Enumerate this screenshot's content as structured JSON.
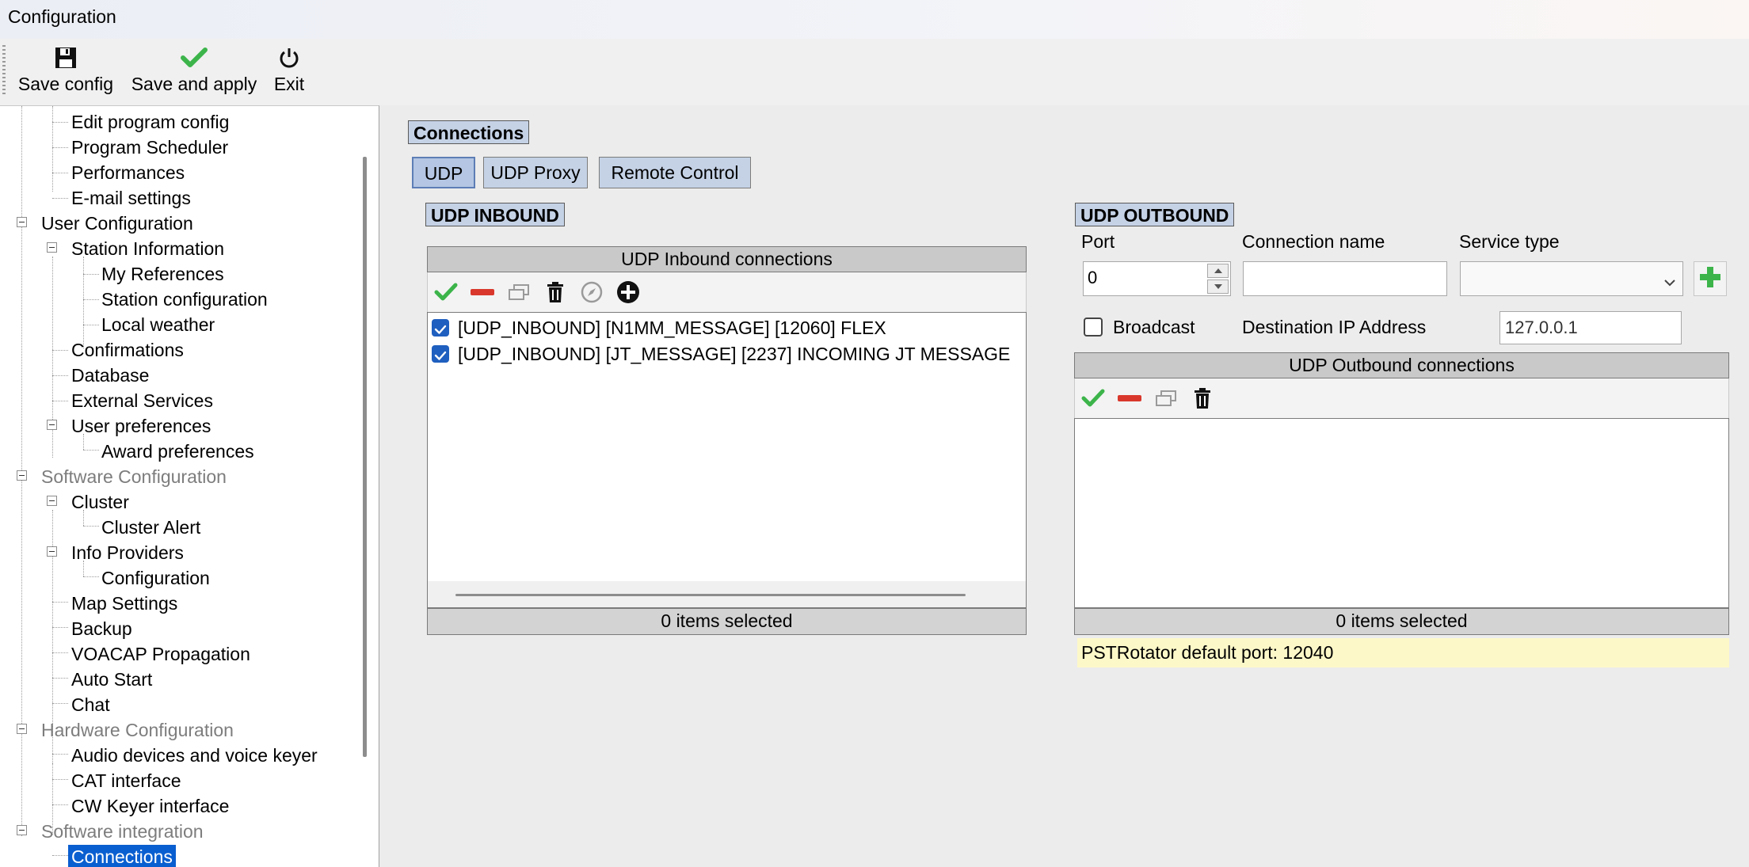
{
  "window": {
    "title": "Configuration"
  },
  "toolbar": {
    "save_config": "Save config",
    "save_apply": "Save and apply",
    "exit": "Exit"
  },
  "tree": {
    "edit_program_config": "Edit program config",
    "program_scheduler": "Program Scheduler",
    "performances": "Performances",
    "email_settings": "E-mail settings",
    "user_configuration": "User Configuration",
    "station_information": "Station Information",
    "my_references": "My References",
    "station_configuration": "Station configuration",
    "local_weather": "Local weather",
    "confirmations": "Confirmations",
    "database": "Database",
    "external_services": "External Services",
    "user_preferences": "User preferences",
    "award_preferences": "Award preferences",
    "software_configuration": "Software Configuration",
    "cluster": "Cluster",
    "cluster_alert": "Cluster Alert",
    "info_providers": "Info Providers",
    "configuration": "Configuration",
    "map_settings": "Map Settings",
    "backup": "Backup",
    "voacap_propagation": "VOACAP Propagation",
    "auto_start": "Auto Start",
    "chat": "Chat",
    "hardware_configuration": "Hardware Configuration",
    "audio_devices": "Audio devices and voice keyer",
    "cat_interface": "CAT interface",
    "cw_keyer_interface": "CW Keyer interface",
    "software_integration": "Software integration",
    "connections": "Connections"
  },
  "main": {
    "section_title": "Connections",
    "tabs": [
      "UDP",
      "UDP Proxy",
      "Remote Control"
    ],
    "inbound": {
      "title": "UDP INBOUND",
      "list_header": "UDP Inbound connections",
      "items": [
        "[UDP_INBOUND] [N1MM_MESSAGE] [12060] FLEX",
        "[UDP_INBOUND] [JT_MESSAGE] [2237] INCOMING JT MESSAGE"
      ],
      "status": "0 items selected"
    },
    "outbound": {
      "title": "UDP OUTBOUND",
      "port_label": "Port",
      "port_value": "0",
      "conn_name_label": "Connection name",
      "conn_name_value": "",
      "service_type_label": "Service type",
      "service_type_value": "",
      "broadcast_label": "Broadcast",
      "broadcast_checked": false,
      "dest_ip_label": "Destination IP Address",
      "dest_ip_value": "127.0.0.1",
      "list_header": "UDP Outbound connections",
      "status": "0 items selected",
      "hint": "PSTRotator default port: 12040"
    }
  },
  "colors": {
    "accent_header": "#c5d2e6",
    "selection": "#0a5fd0",
    "check_green": "#3cb44a",
    "remove_red": "#d9372c",
    "hint_bg": "#fdf8c8"
  },
  "icons": {
    "save_config": "floppy-disk-icon",
    "save_apply": "green-check-icon",
    "exit": "power-icon",
    "enable": "green-check-icon",
    "disable": "red-minus-icon",
    "duplicate": "duplicate-icon",
    "delete": "trash-icon",
    "edit": "compass-icon",
    "add": "add-circle-icon",
    "service_add": "green-plus-icon"
  }
}
